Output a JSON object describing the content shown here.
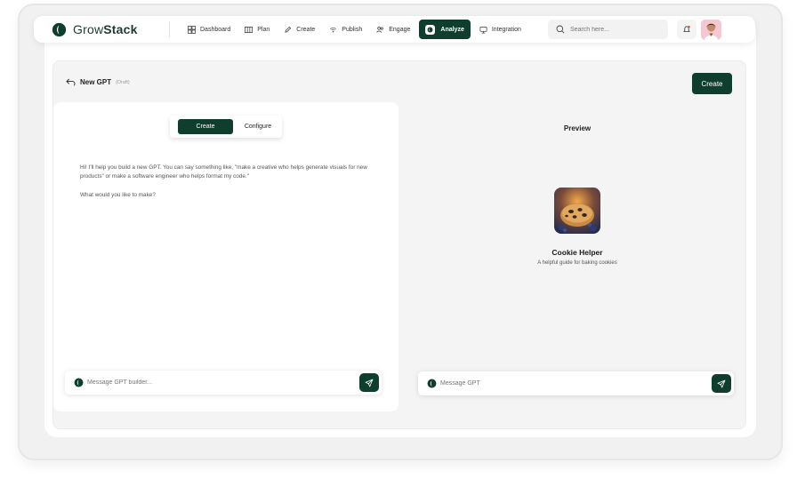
{
  "brand": {
    "name_light": "Grow",
    "name_bold": "Stack",
    "color": "#0f3d2e"
  },
  "nav": {
    "items": [
      {
        "label": "Dashboard",
        "icon": "dashboard-icon"
      },
      {
        "label": "Plan",
        "icon": "plan-icon"
      },
      {
        "label": "Create",
        "icon": "pencil-icon"
      },
      {
        "label": "Publish",
        "icon": "broadcast-icon"
      },
      {
        "label": "Engage",
        "icon": "users-icon"
      },
      {
        "label": "Analyze",
        "icon": "analyze-icon",
        "active": true
      },
      {
        "label": "Integration",
        "icon": "integration-icon"
      }
    ],
    "search_placeholder": "Search here..."
  },
  "page": {
    "title": "New GPT",
    "status": "(Draft)",
    "create_button": "Create"
  },
  "builder": {
    "tabs": [
      "Create",
      "Configure"
    ],
    "active_tab": "Create",
    "intro": "Hi! I'll help you build a new GPT. You can say something like, \"make a creative who helps generate visuals for new products\" or make a software engineer who helps format my code.\"",
    "question": "What would you like to make?",
    "input_placeholder": "Message GPT builder..."
  },
  "preview": {
    "title": "Preview",
    "gpt_name": "Cookie Helper",
    "gpt_description": "A helpful guide for baking cookies",
    "input_placeholder": "Message GPT"
  }
}
